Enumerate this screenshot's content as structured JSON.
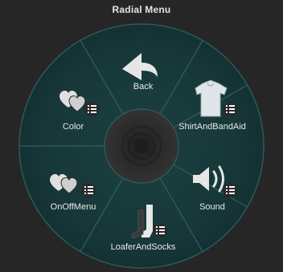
{
  "window": {
    "title": "Radial Menu"
  },
  "menu": {
    "items": [
      {
        "label": "Back",
        "icon": "back-arrow-icon",
        "has_submenu": false
      },
      {
        "label": "ShirtAndBandAid",
        "icon": "shirt-icon",
        "has_submenu": true
      },
      {
        "label": "Sound",
        "icon": "speaker-icon",
        "has_submenu": true
      },
      {
        "label": "LoaferAndSocks",
        "icon": "boot-icon",
        "has_submenu": true
      },
      {
        "label": "OnOffMenu",
        "icon": "hearts-icon",
        "has_submenu": true
      },
      {
        "label": "Color",
        "icon": "hearts-icon",
        "has_submenu": true
      }
    ],
    "center_icon": "radial-hub-icon",
    "submenu_badge_icon": "submenu-list-icon"
  },
  "colors": {
    "background": "#262626",
    "segment_fill": "#19393a",
    "divider": "#2e6060",
    "hub_fill": "#2a2a2a",
    "text": "#e8e8e8"
  }
}
